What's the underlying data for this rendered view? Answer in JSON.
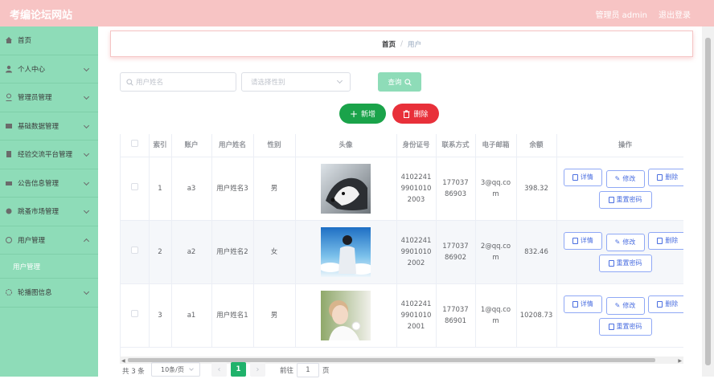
{
  "header": {
    "title": "考编论坛网站",
    "admin_label": "管理员 admin",
    "logout_label": "退出登录"
  },
  "sidebar": {
    "items": [
      {
        "label": "首页",
        "icon": "home-icon"
      },
      {
        "label": "个人中心",
        "icon": "user-icon"
      },
      {
        "label": "管理员管理",
        "icon": "admin-icon"
      },
      {
        "label": "基础数据管理",
        "icon": "data-icon"
      },
      {
        "label": "经验交流平台管理",
        "icon": "forum-icon"
      },
      {
        "label": "公告信息管理",
        "icon": "notice-icon"
      },
      {
        "label": "跳蚤市场管理",
        "icon": "market-icon"
      },
      {
        "label": "用户管理",
        "icon": "users-icon"
      },
      {
        "label": "轮播图信息",
        "icon": "carousel-icon"
      }
    ],
    "active_sub": "用户管理"
  },
  "breadcrumb": {
    "home": "首页",
    "separator": "/",
    "current": "用户"
  },
  "search": {
    "name_placeholder": "用户姓名",
    "gender_placeholder": "请选择性别",
    "button": "查询"
  },
  "actions": {
    "add": "新增",
    "delete": "删除"
  },
  "table": {
    "headers": [
      "索引",
      "账户",
      "用户姓名",
      "性别",
      "头像",
      "身份证号",
      "联系方式",
      "电子邮箱",
      "余额",
      "操作"
    ],
    "rows": [
      {
        "index": "1",
        "account": "a3",
        "name": "用户姓名3",
        "gender": "男",
        "idcard": "410224199010102003",
        "phone": "17703786903",
        "email": "3@qq.com",
        "balance": "398.32"
      },
      {
        "index": "2",
        "account": "a2",
        "name": "用户姓名2",
        "gender": "女",
        "idcard": "410224199010102002",
        "phone": "17703786902",
        "email": "2@qq.com",
        "balance": "832.46"
      },
      {
        "index": "3",
        "account": "a1",
        "name": "用户姓名1",
        "gender": "男",
        "idcard": "410224199010102001",
        "phone": "17703786901",
        "email": "1@qq.com",
        "balance": "10208.73"
      }
    ],
    "op_detail": "详情",
    "op_edit": "修改",
    "op_delete": "删除",
    "op_reset": "重置密码"
  },
  "pagination": {
    "total": "共 3 条",
    "page_size": "10条/页",
    "current_page": "1",
    "goto_label": "前往",
    "goto_value": "1",
    "page_suffix": "页"
  },
  "colors": {
    "header": "#f7c4c4",
    "sidebar": "#8edcb8",
    "add": "#1aa34a",
    "delete": "#e8303a",
    "pager_active": "#20b26b"
  }
}
